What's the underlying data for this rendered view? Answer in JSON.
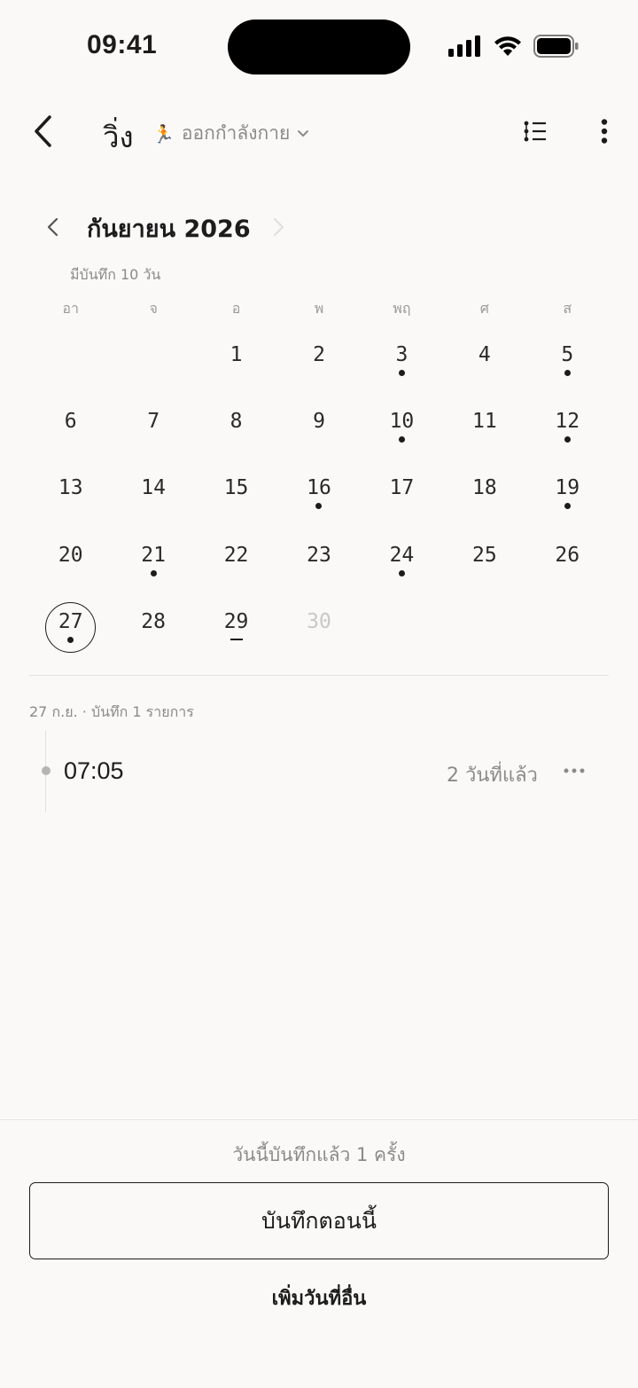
{
  "status_bar": {
    "time": "09:41"
  },
  "nav": {
    "title": "วิ่ง",
    "category_emoji": "🏃",
    "category": "ออกกำลังกาย"
  },
  "calendar": {
    "month_label": "กันยายน 2026",
    "subtitle": "มีบันทึก 10 วัน",
    "weekdays": [
      "อา",
      "จ",
      "อ",
      "พ",
      "พฤ",
      "ศ",
      "ส"
    ],
    "days": [
      {
        "d": "",
        "dot": false
      },
      {
        "d": "",
        "dot": false
      },
      {
        "d": "1",
        "dot": false
      },
      {
        "d": "2",
        "dot": false
      },
      {
        "d": "3",
        "dot": true
      },
      {
        "d": "4",
        "dot": false
      },
      {
        "d": "5",
        "dot": true
      },
      {
        "d": "6",
        "dot": false
      },
      {
        "d": "7",
        "dot": false
      },
      {
        "d": "8",
        "dot": false
      },
      {
        "d": "9",
        "dot": false
      },
      {
        "d": "10",
        "dot": true
      },
      {
        "d": "11",
        "dot": false
      },
      {
        "d": "12",
        "dot": true
      },
      {
        "d": "13",
        "dot": false
      },
      {
        "d": "14",
        "dot": false
      },
      {
        "d": "15",
        "dot": false
      },
      {
        "d": "16",
        "dot": true
      },
      {
        "d": "17",
        "dot": false
      },
      {
        "d": "18",
        "dot": false
      },
      {
        "d": "19",
        "dot": true
      },
      {
        "d": "20",
        "dot": false
      },
      {
        "d": "21",
        "dot": true
      },
      {
        "d": "22",
        "dot": false
      },
      {
        "d": "23",
        "dot": false
      },
      {
        "d": "24",
        "dot": true
      },
      {
        "d": "25",
        "dot": false
      },
      {
        "d": "26",
        "dot": false
      },
      {
        "d": "27",
        "dot": true,
        "today": true
      },
      {
        "d": "28",
        "dot": false
      },
      {
        "d": "29",
        "dash": true
      },
      {
        "d": "30",
        "muted": true
      }
    ]
  },
  "entries": {
    "label": "27 ก.ย. · บันทึก 1 รายการ",
    "items": [
      {
        "time": "07:05",
        "ago": "2 วันที่แล้ว"
      }
    ]
  },
  "footer": {
    "today_count": "วันนี้บันทึกแล้ว 1 ครั้ง",
    "primary_label": "บันทึกตอนนี้",
    "secondary_label": "เพิ่มวันที่อื่น"
  }
}
